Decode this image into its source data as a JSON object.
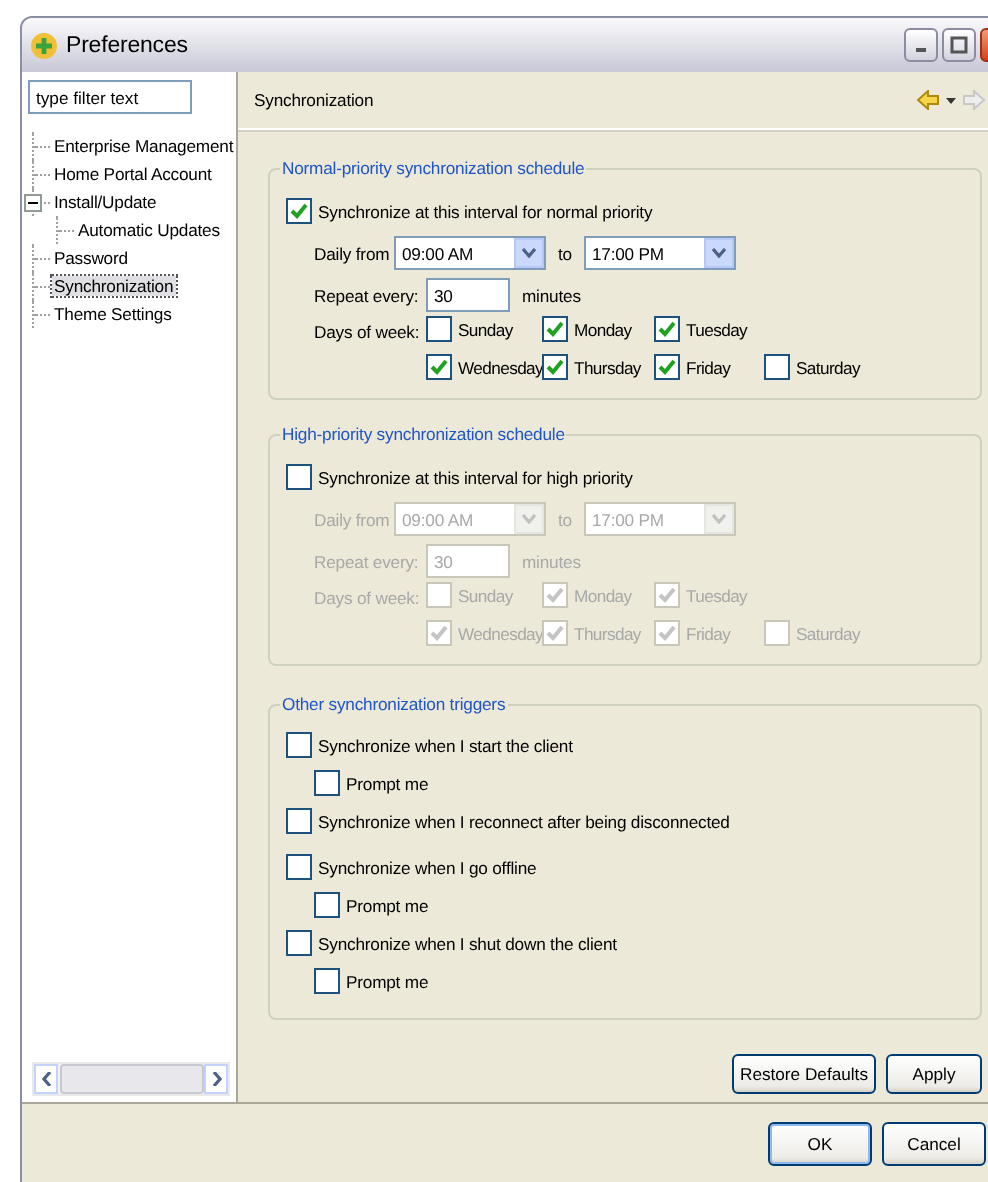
{
  "window": {
    "title": "Preferences"
  },
  "filter": {
    "placeholder": "type filter text"
  },
  "tree": [
    {
      "label": "Enterprise Management",
      "selected": false
    },
    {
      "label": "Home Portal Account",
      "selected": false
    },
    {
      "label": "Install/Update",
      "selected": false,
      "expanded": true,
      "children": [
        {
          "label": "Automatic Updates",
          "selected": false
        }
      ]
    },
    {
      "label": "Password",
      "selected": false
    },
    {
      "label": "Synchronization",
      "selected": true
    },
    {
      "label": "Theme Settings",
      "selected": false
    }
  ],
  "page": {
    "title": "Synchronization"
  },
  "schedules": [
    {
      "title": "Normal-priority synchronization schedule",
      "disabled": false,
      "enable": {
        "label": "Synchronize at this interval for normal priority",
        "checked": true
      },
      "daily_from_label": "Daily from",
      "from": "09:00 AM",
      "to_label": "to",
      "to": "17:00 PM",
      "repeat_label": "Repeat every:",
      "repeat": "30",
      "unit": "minutes",
      "days_label": "Days of week:",
      "days": [
        {
          "label": "Sunday",
          "checked": false
        },
        {
          "label": "Monday",
          "checked": true
        },
        {
          "label": "Tuesday",
          "checked": true
        },
        {
          "label": "Wednesday",
          "checked": true
        },
        {
          "label": "Thursday",
          "checked": true
        },
        {
          "label": "Friday",
          "checked": true
        },
        {
          "label": "Saturday",
          "checked": false
        }
      ]
    },
    {
      "title": "High-priority synchronization schedule",
      "disabled": true,
      "enable": {
        "label": "Synchronize at this interval for high priority",
        "checked": false
      },
      "daily_from_label": "Daily from",
      "from": "09:00 AM",
      "to_label": "to",
      "to": "17:00 PM",
      "repeat_label": "Repeat every:",
      "repeat": "30",
      "unit": "minutes",
      "days_label": "Days of week:",
      "days": [
        {
          "label": "Sunday",
          "checked": false
        },
        {
          "label": "Monday",
          "checked": true
        },
        {
          "label": "Tuesday",
          "checked": true
        },
        {
          "label": "Wednesday",
          "checked": true
        },
        {
          "label": "Thursday",
          "checked": true
        },
        {
          "label": "Friday",
          "checked": true
        },
        {
          "label": "Saturday",
          "checked": false
        }
      ]
    }
  ],
  "triggers": {
    "title": "Other synchronization triggers",
    "items": [
      {
        "label": "Synchronize when I start the client",
        "checked": false,
        "prompt": {
          "label": "Prompt me",
          "checked": false
        }
      },
      {
        "label": "Synchronize when I reconnect after being disconnected",
        "checked": false
      },
      {
        "label": "Synchronize when I go offline",
        "checked": false,
        "prompt": {
          "label": "Prompt me",
          "checked": false
        }
      },
      {
        "label": "Synchronize when I shut down the client",
        "checked": false,
        "prompt": {
          "label": "Prompt me",
          "checked": false
        }
      }
    ]
  },
  "page_buttons": [
    "Restore Defaults",
    "Apply"
  ],
  "dialog_buttons": [
    "OK",
    "Cancel"
  ]
}
